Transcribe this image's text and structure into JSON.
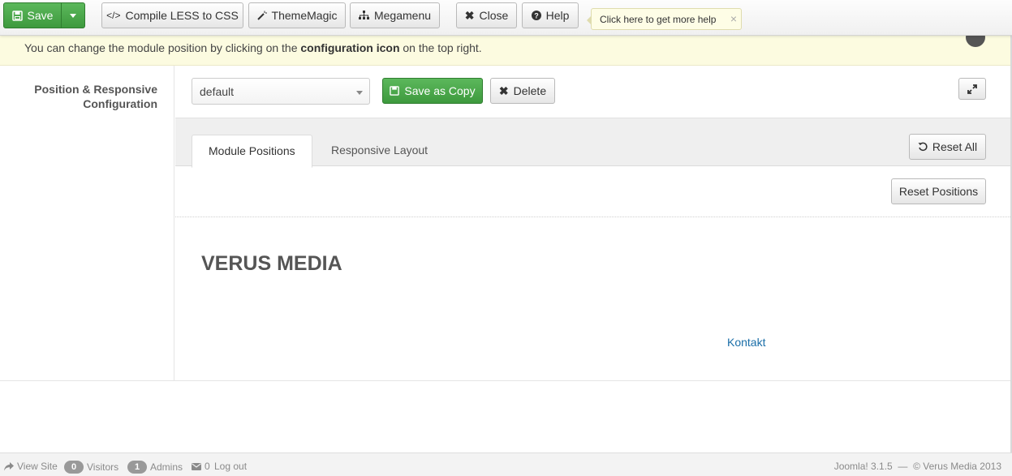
{
  "toolbar": {
    "save_label": "Save",
    "compile_label": "Compile LESS to CSS",
    "thememagic_label": "ThemeMagic",
    "megamenu_label": "Megamenu",
    "close_label": "Close",
    "help_label": "Help",
    "help_tip": "Click here to get more help"
  },
  "notice": {
    "text_before": "You can change the module position by clicking on the ",
    "text_bold": "configuration icon",
    "text_after": " on the top right."
  },
  "section": {
    "label": "Position & Responsive Configuration"
  },
  "layout": {
    "selected": "default",
    "save_copy_label": "Save as Copy",
    "delete_label": "Delete"
  },
  "tabs": [
    {
      "label": "Module Positions",
      "active": true
    },
    {
      "label": "Responsive Layout",
      "active": false
    }
  ],
  "actions": {
    "reset_all_label": "Reset All",
    "reset_positions_label": "Reset Positions"
  },
  "preview": {
    "brand": "VERUS MEDIA",
    "link": "Kontakt"
  },
  "statusbar": {
    "view_site": "View Site",
    "visitors_count": "0",
    "visitors_label": "Visitors",
    "admins_count": "1",
    "admins_label": "Admins",
    "messages_count": "0",
    "logout_label": "Log out",
    "version": "Joomla! 3.1.5",
    "separator": "—",
    "copyright": "© Verus Media 2013"
  },
  "colors": {
    "accent_green": "#4cae4c",
    "link_blue": "#1a6ea8",
    "notice_bg": "#fcfbe0"
  }
}
